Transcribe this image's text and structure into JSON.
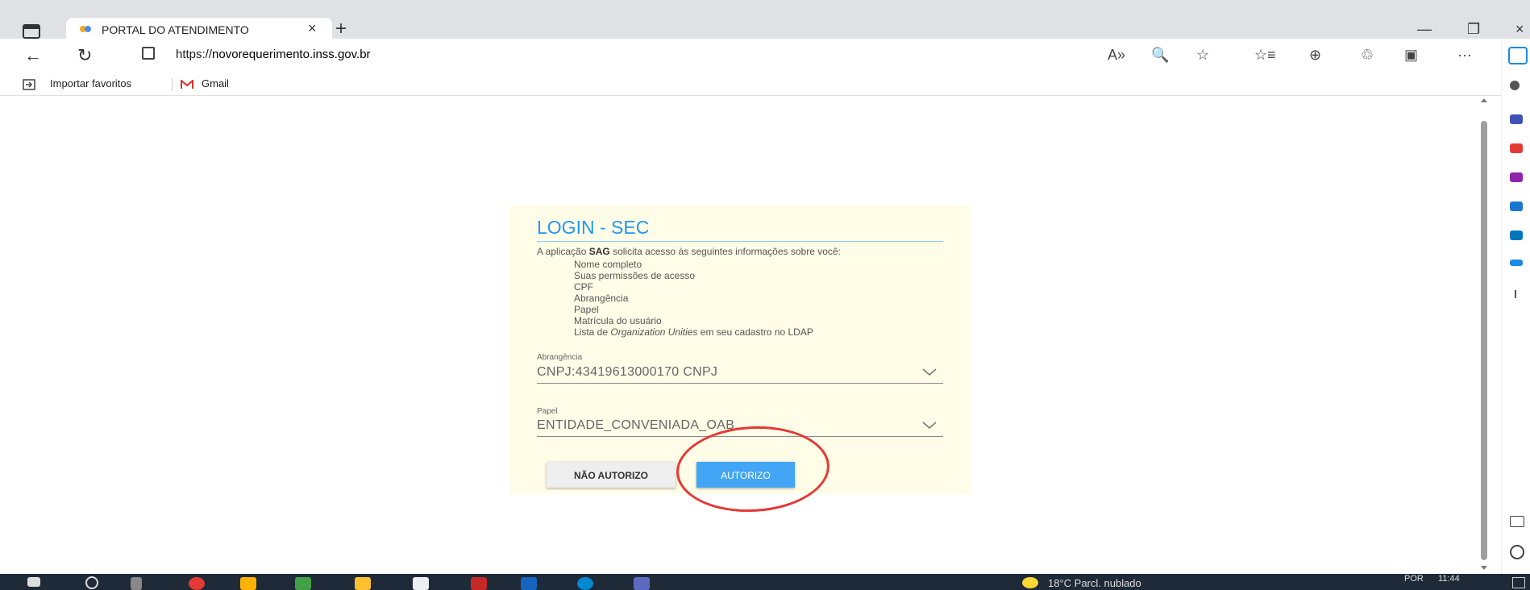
{
  "browser": {
    "tab": {
      "title": "PORTAL DO ATENDIMENTO",
      "close": "×"
    },
    "new_tab": "+",
    "window_controls": {
      "minimize": "—",
      "restore": "❐",
      "close": "×"
    },
    "nav": {
      "back": "←",
      "refresh": "↻"
    },
    "address": {
      "prefix": "https://",
      "domain": "novorequerimento.inss.gov.br"
    },
    "toolbar_icons": {
      "read_aloud": "A»",
      "zoom": "🔍",
      "favorite": "☆",
      "favorites": "☆≡",
      "collections": "⊕",
      "extensions": "♲",
      "profile": "▣",
      "more": "···"
    },
    "favorites_bar": [
      {
        "label": "Importar favoritos",
        "icon": "import-icon"
      },
      {
        "label": "Gmail",
        "icon": "gmail-icon"
      }
    ]
  },
  "login": {
    "title": "LOGIN - SEC",
    "intro_pre": "A aplicação ",
    "intro_app": "SAG",
    "intro_post": " solicita acesso às seguintes informações sobre você:",
    "permissions": [
      "Nome completo",
      "Suas permissões de acesso",
      "CPF",
      "Abrangência",
      "Papel",
      "Matrícula do usuário"
    ],
    "last_permission": {
      "pre": "Lista de ",
      "italic": "Organization Unities",
      "post": " em seu cadastro no LDAP"
    },
    "abrangencia": {
      "label": "Abrangência",
      "value": "CNPJ:43419613000170 CNPJ"
    },
    "papel": {
      "label": "Papel",
      "value": "ENTIDADE_CONVENIADA_OAB"
    },
    "btn_deny": "NÃO AUTORIZO",
    "btn_allow": "AUTORIZO"
  },
  "taskbar": {
    "weather": "18°C  Parcl. nublado",
    "language": "POR",
    "time": "11:44"
  },
  "colors": {
    "accent": "#42a5f5",
    "title_blue": "#2196f3",
    "panel_bg": "#fffde8",
    "annotation": "#e53935"
  }
}
